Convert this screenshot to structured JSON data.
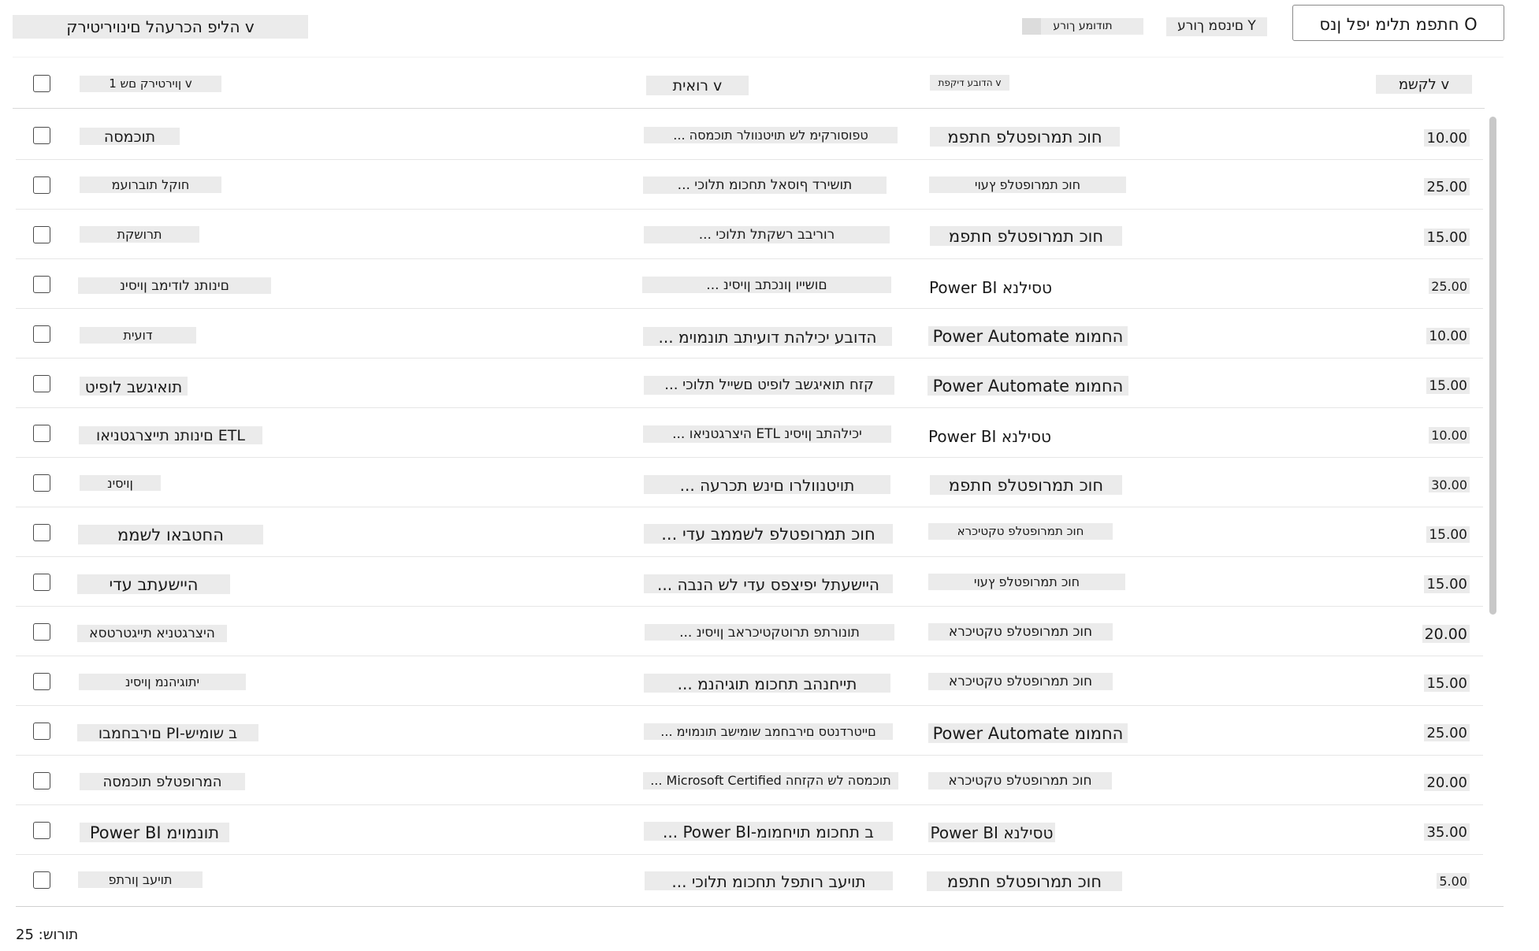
{
  "toolbar": {
    "filter_label": "הליפ הכרעהל םינויריטירק v",
    "search_value": "חתפמ תלימ יפל ןנס O",
    "sort_label": "םינסמ ךורע Y",
    "compact_toggle_label": "תודומע ךורע"
  },
  "header": {
    "certification": "ןוירטירק םש 1 v",
    "description": "רואית v",
    "area": "הדובע דיקפת v",
    "price": "לקשמ v"
  },
  "rows": [
    {
      "certification": "תוכמסה",
      "description": "... טפוסורקימ לש תויטנוולר תוכמסה",
      "area": "חוכ תמרופטלפ חתפמ",
      "price": "10.00"
    },
    {
      "certification": "חוקל תוברועמ",
      "description": "... תושירד ףוסאל תחכומ תלוכי",
      "area": "חוכ תמרופטלפ ץעוי",
      "price": "25.00"
    },
    {
      "certification": "תרושקת",
      "description": "... רוריבב רשקתל תלוכי",
      "area": "חוכ תמרופטלפ חתפמ",
      "price": "15.00"
    },
    {
      "certification": "םינותנ לודימב ןויסינ",
      "description": "... םושייו ןונכתב ןויסינ",
      "area": "Power BI טסילנא",
      "price": "25.00"
    },
    {
      "certification": "דועית",
      "description": "... הדובע יכילהת דועיתב תונמוימ",
      "area": "Power Automate החמומ",
      "price": "10.00"
    },
    {
      "certification": "תואיגשב לופיט",
      "description": "... קזח תואיגשב לופיט םשייל תלוכי",
      "area": "Power Automate החמומ",
      "price": "15.00"
    },
    {
      "certification": "םינותנ תייצרגטניאו ETL",
      "description": "... היצרגטניאו ETL יכילהתב ןויסינ",
      "area": "Power BI טסילנא",
      "price": "10.00"
    },
    {
      "certification": "ןויסינ",
      "description": "... תויטנוולרו םינש תכרעה",
      "area": "חוכ תמרופטלפ חתפמ",
      "price": "30.00"
    },
    {
      "certification": "החטבאו לשממ",
      "description": "... חוכ תמרופטלפ לשממב עדי",
      "area": "חוכ תמרופטלפ טקטיכרא",
      "price": "15.00"
    },
    {
      "certification": "היישעתב עדי",
      "description": "... היישעתל יפיצפס עדי לש הנבה",
      "area": "חוכ תמרופטלפ ץעוי",
      "price": "15.00"
    },
    {
      "certification": "היצרגטניא תייגטרטסא",
      "description": "... תונורתפ תרוטקטיכראב ןויסינ",
      "area": "חוכ תמרופטלפ טקטיכרא",
      "price": "20.00"
    },
    {
      "certification": "יתוגיהנמ ןויסינ",
      "description": "... תייחנהב תחכומ תוגיהנמ",
      "area": "חוכ תמרופטלפ טקטיכרא",
      "price": "15.00"
    },
    {
      "certification": "םירבחמבו PI-ב שומיש",
      "description": "... םייטרדנטס םירבחמב שומישב תונמוימ",
      "area": "Power Automate החמומ",
      "price": "25.00"
    },
    {
      "certification": "המרופטלפ תוכמסה",
      "description": "... Microsoft Certified תוכמסה לש הקזחה",
      "area": "חוכ תמרופטלפ טקטיכרא",
      "price": "20.00"
    },
    {
      "certification": "Power BI תונמוימ",
      "description": "... Power BI-ב תחכומ תויחמומ",
      "area": "Power BI טסילנא",
      "price": "35.00"
    },
    {
      "certification": "תויעב ןורתפ",
      "description": "... תויעב רותפל תחכומ תלוכי",
      "area": "חוכ תמרופטלפ חתפמ",
      "price": "5.00"
    }
  ],
  "footer": {
    "count_label": "תורוש: 25"
  }
}
